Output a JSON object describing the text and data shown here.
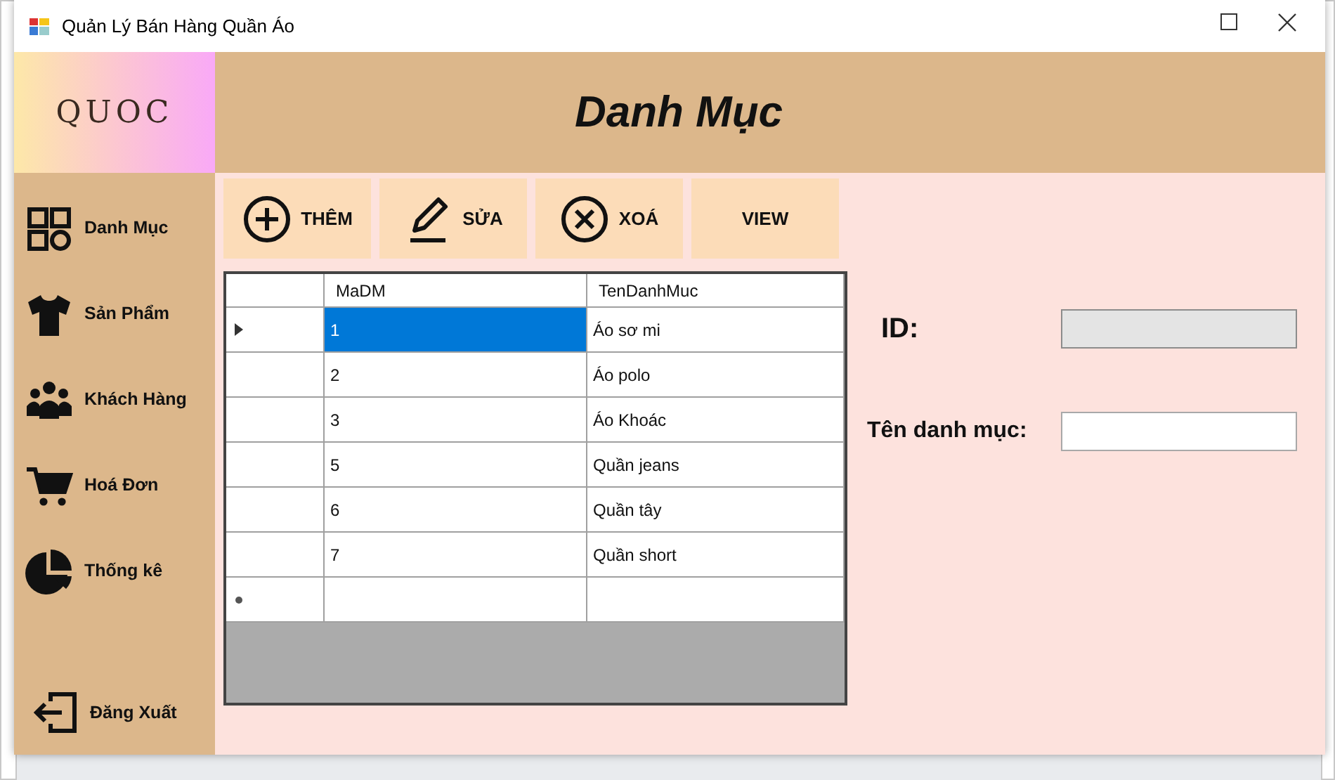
{
  "window": {
    "title": "Quản Lý Bán Hàng Quần Áo"
  },
  "logo": {
    "text": "QUOC"
  },
  "header": {
    "title": "Danh Mục"
  },
  "sidebar": {
    "items": [
      {
        "label": "Danh Mục",
        "kind": "grid"
      },
      {
        "label": "Sản Phẩm",
        "kind": "shirt"
      },
      {
        "label": "Khách Hàng",
        "kind": "people"
      },
      {
        "label": "Hoá Đơn",
        "kind": "cart"
      },
      {
        "label": "Thống kê",
        "kind": "pie"
      },
      {
        "label": "Đăng Xuất",
        "kind": "logout"
      }
    ]
  },
  "toolbar": {
    "buttons": [
      {
        "label": "THÊM",
        "kind": "plus"
      },
      {
        "label": "SỬA",
        "kind": "pencil"
      },
      {
        "label": "XOÁ",
        "kind": "cross"
      },
      {
        "label": "VIEW",
        "kind": "text"
      }
    ]
  },
  "table": {
    "columns": [
      "MaDM",
      "TenDanhMuc"
    ],
    "rows": [
      {
        "current": true,
        "cells": [
          {
            "text": "1",
            "selected": true
          },
          {
            "text": "Áo sơ mi",
            "selected": false
          }
        ]
      },
      {
        "current": false,
        "cells": [
          {
            "text": "2",
            "selected": false
          },
          {
            "text": "Áo polo",
            "selected": false
          }
        ]
      },
      {
        "current": false,
        "cells": [
          {
            "text": "3",
            "selected": false
          },
          {
            "text": "Áo Khoác",
            "selected": false
          }
        ]
      },
      {
        "current": false,
        "cells": [
          {
            "text": "5",
            "selected": false
          },
          {
            "text": "Quần jeans",
            "selected": false
          }
        ]
      },
      {
        "current": false,
        "cells": [
          {
            "text": "6",
            "selected": false
          },
          {
            "text": "Quần tây",
            "selected": false
          }
        ]
      },
      {
        "current": false,
        "cells": [
          {
            "text": "7",
            "selected": false
          },
          {
            "text": "Quần short",
            "selected": false
          }
        ]
      }
    ],
    "new_row": true
  },
  "form": {
    "fields": [
      {
        "label": "ID:",
        "disabled": true,
        "kind": "large"
      },
      {
        "label": "Tên danh mục:",
        "disabled": false,
        "kind": "normal"
      }
    ]
  }
}
